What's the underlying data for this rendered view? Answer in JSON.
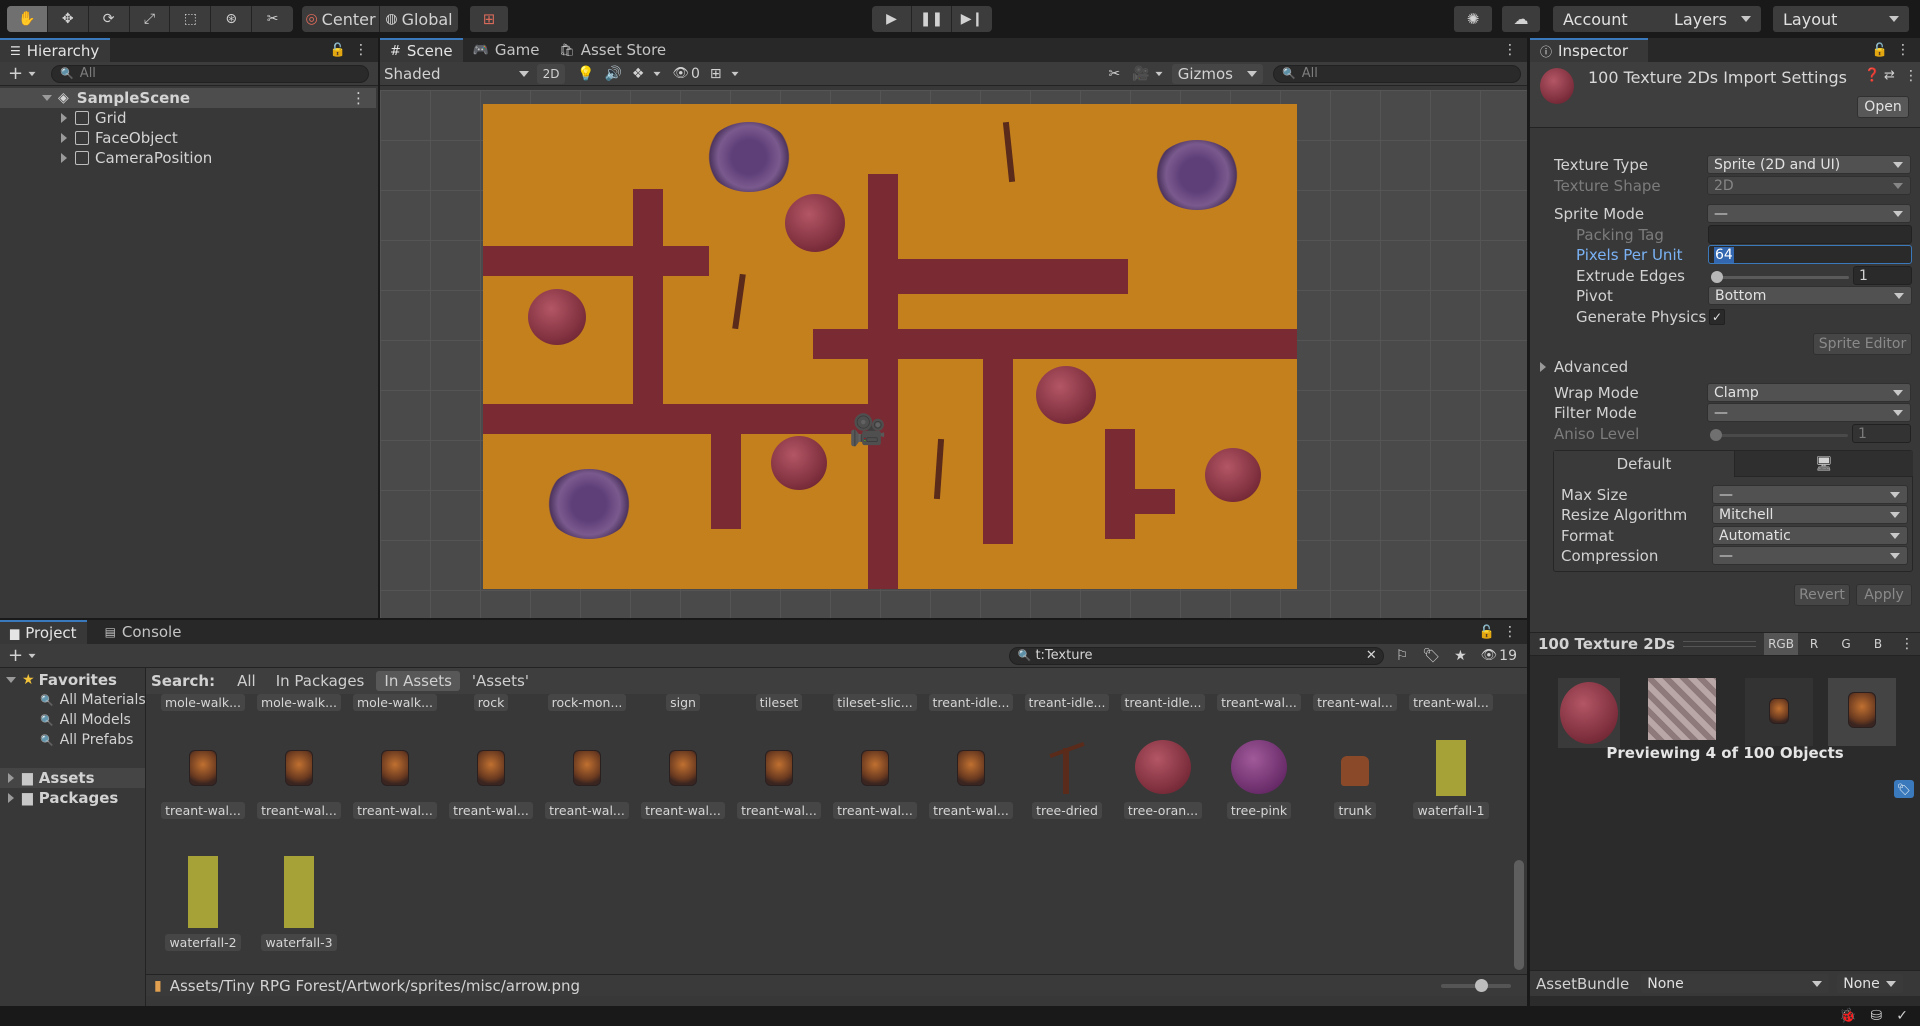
{
  "toolbar": {
    "pivot_center": "Center",
    "pivot_global": "Global",
    "account": "Account",
    "layers": "Layers",
    "layout": "Layout"
  },
  "hierarchy": {
    "tab": "Hierarchy",
    "search_placeholder": "All",
    "scene": "SampleScene",
    "items": [
      {
        "label": "Grid"
      },
      {
        "label": "FaceObject"
      },
      {
        "label": "CameraPosition"
      }
    ]
  },
  "scene": {
    "tabs": [
      "Scene",
      "Game",
      "Asset Store"
    ],
    "shading": "Shaded",
    "mode_2d": "2D",
    "hidden_count": "0",
    "gizmos": "Gizmos",
    "search_placeholder": "All"
  },
  "inspector": {
    "tab": "Inspector",
    "title": "100 Texture 2Ds Import Settings",
    "open": "Open",
    "texture_type_label": "Texture Type",
    "texture_type": "Sprite (2D and UI)",
    "texture_shape_label": "Texture Shape",
    "texture_shape": "2D",
    "sprite_mode_label": "Sprite Mode",
    "sprite_mode": "—",
    "packing_tag_label": "Packing Tag",
    "ppu_label": "Pixels Per Unit",
    "ppu": "64",
    "extrude_label": "Extrude Edges",
    "extrude": "1",
    "pivot_label": "Pivot",
    "pivot": "Bottom",
    "gen_physics_label": "Generate Physics",
    "sprite_editor": "Sprite Editor",
    "advanced": "Advanced",
    "wrap_label": "Wrap Mode",
    "wrap": "Clamp",
    "filter_label": "Filter Mode",
    "filter": "—",
    "aniso_label": "Aniso Level",
    "aniso": "1",
    "platform_default": "Default",
    "max_size_label": "Max Size",
    "max_size": "—",
    "resize_label": "Resize Algorithm",
    "resize": "Mitchell",
    "format_label": "Format",
    "format": "Automatic",
    "compression_label": "Compression",
    "compression": "—",
    "revert": "Revert",
    "apply": "Apply",
    "preview_title": "100 Texture 2Ds",
    "channels": [
      "RGB",
      "R",
      "G",
      "B"
    ],
    "preview_caption": "Previewing 4 of 100 Objects",
    "assetbundle_label": "AssetBundle",
    "assetbundle": "None",
    "assetbundle_variant": "None"
  },
  "project": {
    "tabs": [
      "Project",
      "Console"
    ],
    "search_value": "t:Texture",
    "hidden_count": "19",
    "favorites": "Favorites",
    "fav_items": [
      "All Materials",
      "All Models",
      "All Prefabs"
    ],
    "roots": [
      "Assets",
      "Packages"
    ],
    "search_label": "Search:",
    "scopes": [
      "All",
      "In Packages",
      "In Assets",
      "'Assets'"
    ],
    "row1": [
      "mole-walk...",
      "mole-walk...",
      "mole-walk...",
      "rock",
      "rock-mon...",
      "sign",
      "tileset",
      "tileset-slic...",
      "treant-idle...",
      "treant-idle...",
      "treant-idle...",
      "treant-wal...",
      "treant-wal...",
      "treant-wal..."
    ],
    "row2": [
      "treant-wal...",
      "treant-wal...",
      "treant-wal...",
      "treant-wal...",
      "treant-wal...",
      "treant-wal...",
      "treant-wal...",
      "treant-wal...",
      "treant-wal...",
      "tree-dried",
      "tree-oran...",
      "tree-pink",
      "trunk",
      "waterfall-1"
    ],
    "row3": [
      "waterfall-2",
      "waterfall-3"
    ],
    "path": "Assets/Tiny RPG Forest/Artwork/sprites/misc/arrow.png"
  },
  "colors": {
    "accent": "#3a79bb",
    "ground": "#c4801d",
    "road": "#7a2a33"
  }
}
